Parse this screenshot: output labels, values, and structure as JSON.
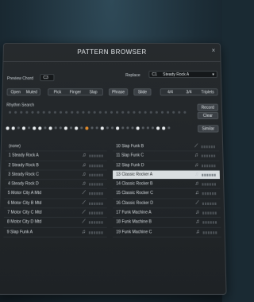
{
  "title": "PATTERN BROWSER",
  "close_glyph": "×",
  "preview_chord": {
    "label": "Preview Chord",
    "value": "C3"
  },
  "replace": {
    "label": "Replace",
    "slot": "C1",
    "pattern": "Steady Rock A"
  },
  "voicing_buttons": [
    "Open",
    "Muted"
  ],
  "technique_buttons": [
    "Pick",
    "Finger",
    "Slap"
  ],
  "phrase_label": "Phrase",
  "slide_label": "Slide",
  "meter_buttons": [
    "4/4",
    "3/4",
    "Triplets"
  ],
  "rhythm_search": {
    "label": "Rhythm Search",
    "record": "Record",
    "clear": "Clear"
  },
  "similar_label": "Similar",
  "colors": {
    "accent_dot": "#e08a2a",
    "selected_row": "#d9dee1"
  },
  "left_list": [
    {
      "name": "(none)",
      "icon": ""
    },
    {
      "name": "1 Steady Rock A",
      "icon": "music-note-icon"
    },
    {
      "name": "2 Steady Rock B",
      "icon": "music-note-icon"
    },
    {
      "name": "3 Steady Rock C",
      "icon": "music-note-icon"
    },
    {
      "name": "4 Steady Rock D",
      "icon": "music-note-icon"
    },
    {
      "name": "5 Motor City A Mtd",
      "icon": "slide-icon"
    },
    {
      "name": "6 Motor City B Mtd",
      "icon": "slide-icon"
    },
    {
      "name": "7 Motor City C Mtd",
      "icon": "slide-icon"
    },
    {
      "name": "8 Motor City D Mtd",
      "icon": "slide-icon"
    },
    {
      "name": "9 Slap Funk A",
      "icon": "music-note-icon"
    }
  ],
  "right_list": [
    {
      "name": "10 Slap Funk B",
      "icon": "slide-icon"
    },
    {
      "name": "11 Slap Funk C",
      "icon": "music-note-icon"
    },
    {
      "name": "12 Slap Funk D",
      "icon": "music-note-icon"
    },
    {
      "name": "13 Classic Rocker A",
      "icon": "music-note-icon",
      "selected": true
    },
    {
      "name": "14 Classic Rocker B",
      "icon": "music-note-icon"
    },
    {
      "name": "15 Classic Rocker C",
      "icon": "music-note-icon"
    },
    {
      "name": "16 Classic Rocker D",
      "icon": "slide-icon"
    },
    {
      "name": "17 Funk Machine A",
      "icon": "music-note-icon"
    },
    {
      "name": "18 Funk Machine B",
      "icon": "music-note-icon"
    },
    {
      "name": "19 Funk Machine C",
      "icon": "music-note-icon"
    }
  ]
}
